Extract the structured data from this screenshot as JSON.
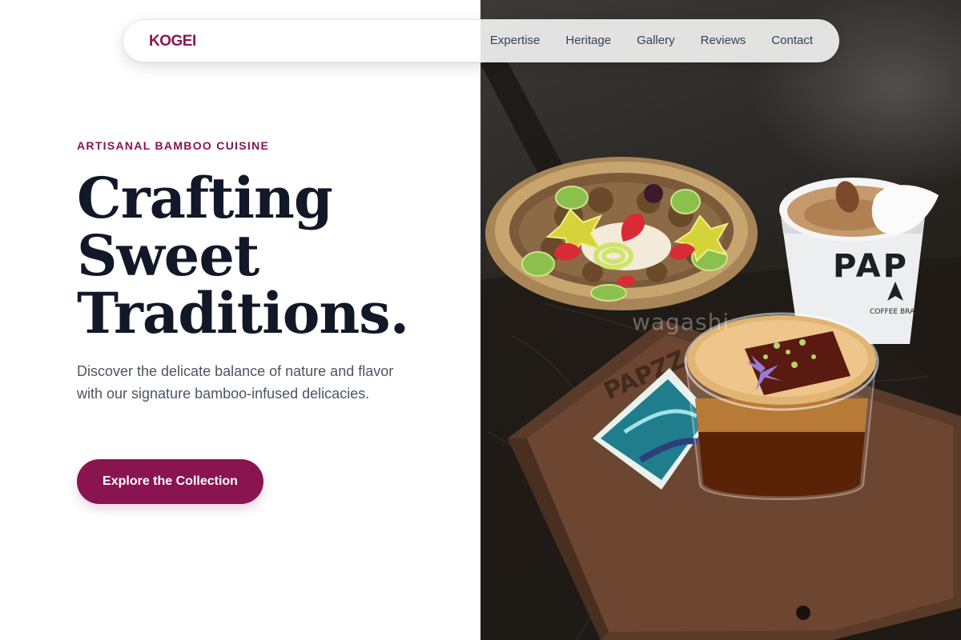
{
  "nav": {
    "brand": "KOGEI",
    "links": [
      "Expertise",
      "Heritage",
      "Gallery",
      "Reviews",
      "Contact"
    ]
  },
  "hero": {
    "eyebrow": "ARTISANAL BAMBOO CUISINE",
    "headline_lines": [
      "Crafting",
      "Sweet",
      "Traditions."
    ],
    "description": "Discover the delicate balance of nature and flavor with our signature bamboo-infused delicacies.",
    "cta_label": "Explore the Collection"
  },
  "photo": {
    "cup_print": "PAP",
    "cup_subprint": "COFFEE BRAND",
    "tray_engraving": "PAPZZ",
    "watermark": "wagashi"
  },
  "colors": {
    "accent": "#8a1450",
    "heading": "#111827",
    "body_text": "#4b5563",
    "nav_text": "#374151",
    "background": "#ffffff"
  }
}
